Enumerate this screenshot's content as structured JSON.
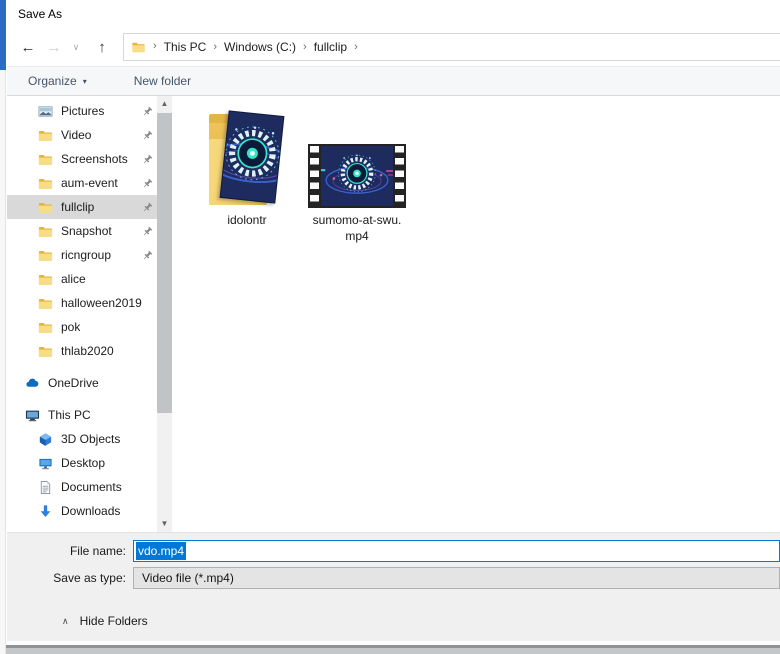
{
  "window": {
    "title": "Save As"
  },
  "colors": {
    "selection_blue": "#0078d7",
    "sidebar_selected_bg": "#d9d9d9",
    "folder_yellow": "#eec45c",
    "toolbar_text": "#44546a",
    "background_edge_blue": "#2b6cc4"
  },
  "icons": {
    "back_arrow": "←",
    "forward_arrow": "→",
    "nav_dropdown_chevron": "∨",
    "up_arrow": "↑",
    "breadcrumb_chevron": "›",
    "organize_caret": "▾",
    "hide_folders_chevron": "∧",
    "scroll_up": "▲",
    "scroll_down": "▼"
  },
  "nav": {
    "breadcrumb": [
      {
        "label": "This PC"
      },
      {
        "label": "Windows (C:)"
      },
      {
        "label": "fullclip"
      }
    ]
  },
  "toolbar": {
    "organize_label": "Organize",
    "new_folder_label": "New folder"
  },
  "sidebar": {
    "items": [
      {
        "label": "Pictures",
        "icon": "pictures",
        "indent": 2,
        "pinned": true,
        "selected": false,
        "gap_before": false
      },
      {
        "label": "Video",
        "icon": "folder",
        "indent": 2,
        "pinned": true,
        "selected": false,
        "gap_before": false
      },
      {
        "label": "Screenshots",
        "icon": "folder",
        "indent": 2,
        "pinned": true,
        "selected": false,
        "gap_before": false
      },
      {
        "label": "aum-event",
        "icon": "folder",
        "indent": 2,
        "pinned": true,
        "selected": false,
        "gap_before": false
      },
      {
        "label": "fullclip",
        "icon": "folder",
        "indent": 2,
        "pinned": true,
        "selected": true,
        "gap_before": false
      },
      {
        "label": "Snapshot",
        "icon": "folder",
        "indent": 2,
        "pinned": true,
        "selected": false,
        "gap_before": false
      },
      {
        "label": "ricngroup",
        "icon": "folder",
        "indent": 2,
        "pinned": true,
        "selected": false,
        "gap_before": false
      },
      {
        "label": "alice",
        "icon": "folder",
        "indent": 2,
        "pinned": false,
        "selected": false,
        "gap_before": false
      },
      {
        "label": "halloween2019",
        "icon": "folder",
        "indent": 2,
        "pinned": false,
        "selected": false,
        "gap_before": false
      },
      {
        "label": "pok",
        "icon": "folder",
        "indent": 2,
        "pinned": false,
        "selected": false,
        "gap_before": false
      },
      {
        "label": "thlab2020",
        "icon": "folder",
        "indent": 2,
        "pinned": false,
        "selected": false,
        "gap_before": false
      },
      {
        "label": "OneDrive",
        "icon": "onedrive",
        "indent": 1,
        "pinned": false,
        "selected": false,
        "gap_before": true
      },
      {
        "label": "This PC",
        "icon": "this-pc",
        "indent": 1,
        "pinned": false,
        "selected": false,
        "gap_before": true
      },
      {
        "label": "3D Objects",
        "icon": "3d-objects",
        "indent": 2,
        "pinned": false,
        "selected": false,
        "gap_before": false
      },
      {
        "label": "Desktop",
        "icon": "desktop",
        "indent": 2,
        "pinned": false,
        "selected": false,
        "gap_before": false
      },
      {
        "label": "Documents",
        "icon": "documents",
        "indent": 2,
        "pinned": false,
        "selected": false,
        "gap_before": false
      },
      {
        "label": "Downloads",
        "icon": "downloads",
        "indent": 2,
        "pinned": false,
        "selected": false,
        "gap_before": false
      }
    ]
  },
  "files": {
    "items": [
      {
        "name": "idolontr",
        "type": "folder"
      },
      {
        "name": "sumomo-at-swu.mp4",
        "type": "video",
        "name_lines": [
          "sumomo-at-swu.",
          "mp4"
        ]
      }
    ]
  },
  "form": {
    "file_name_label": "File name:",
    "file_name_value": "vdo.mp4",
    "save_as_type_label": "Save as type:",
    "save_as_type_value": "Video file (*.mp4)"
  },
  "footer": {
    "hide_folders_label": "Hide Folders"
  }
}
